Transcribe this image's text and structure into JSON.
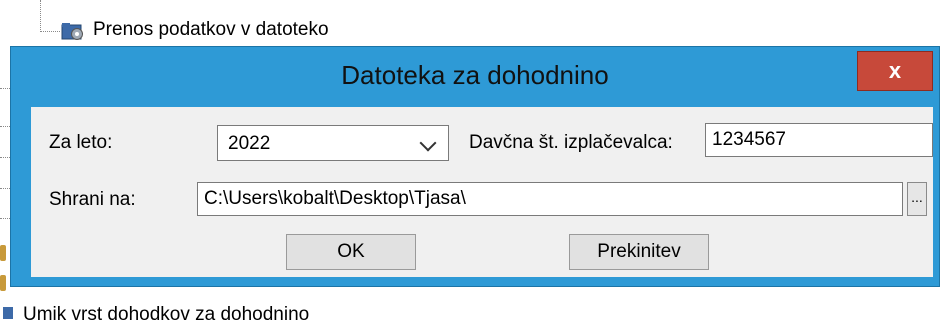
{
  "tree": {
    "node_label": "Prenos podatkov v datoteko",
    "bottom_label": "Umik vrst dohodkov za dohodnino"
  },
  "dialog": {
    "title": "Datoteka za dohodnino",
    "close_label": "x",
    "year": {
      "label": "Za leto:",
      "value": "2022"
    },
    "tax_number": {
      "label": "Davčna št. izplačevalca:",
      "value": "1234567"
    },
    "save_to": {
      "label": "Shrani na:",
      "value": "C:\\Users\\kobalt\\Desktop\\Tjasa\\"
    },
    "browse_label": "...",
    "ok_label": "OK",
    "cancel_label": "Prekinitev"
  },
  "colors": {
    "frame": "#2e9ad6",
    "close": "#c7493a",
    "client": "#f0f0f0"
  },
  "icons": [
    "gear-folder-icon",
    "close-icon",
    "chevron-down-icon",
    "tree-item-icon"
  ]
}
